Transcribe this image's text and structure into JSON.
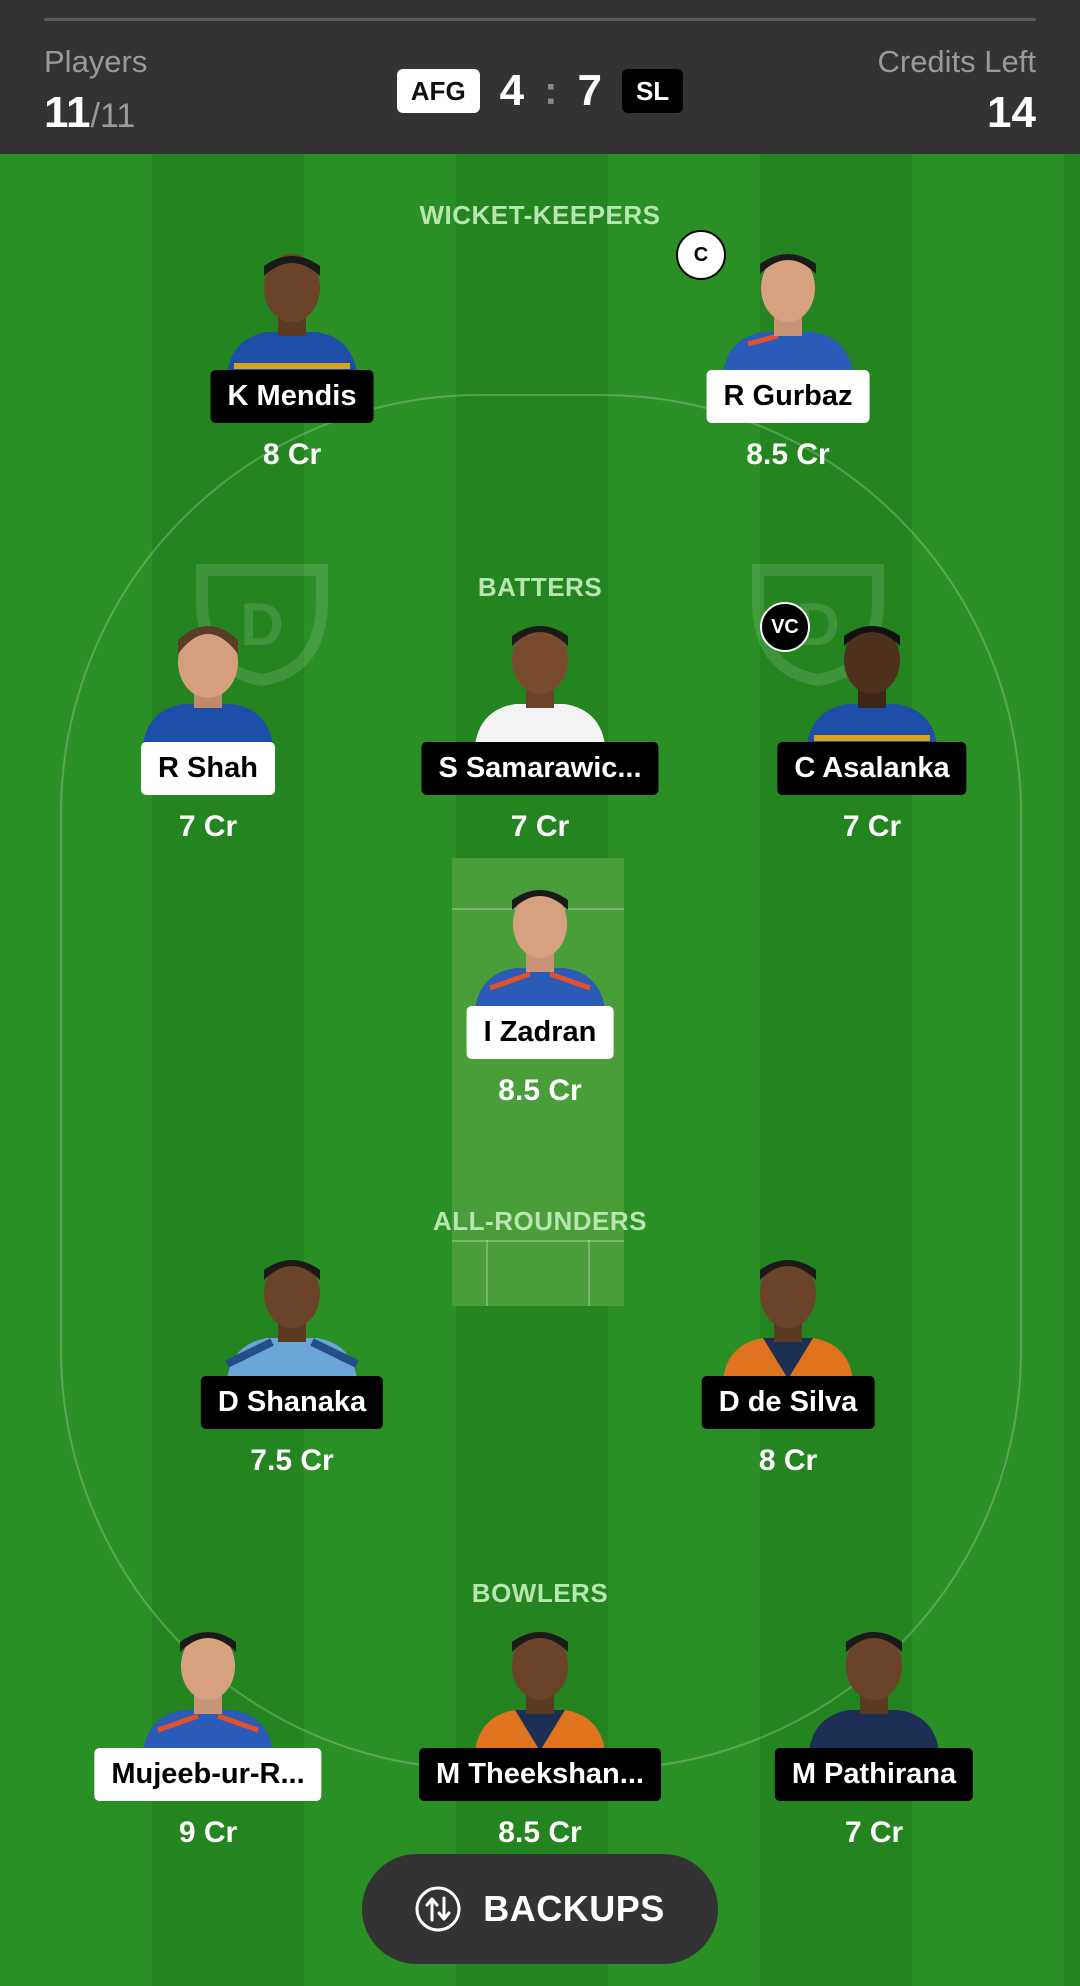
{
  "header": {
    "players_label": "Players",
    "players_count": "11",
    "players_total": "/11",
    "credits_label": "Credits Left",
    "credits_value": "14",
    "team1": "AFG",
    "team1_score": "4",
    "separator": ":",
    "team2_score": "7",
    "team2": "SL"
  },
  "sections": {
    "wicket_keepers": "WICKET-KEEPERS",
    "batters": "BATTERS",
    "all_rounders": "ALL-ROUNDERS",
    "bowlers": "BOWLERS"
  },
  "players": [
    {
      "name": "K Mendis",
      "credits": "8 Cr",
      "team": "SL",
      "label_style": "dark"
    },
    {
      "name": "R Gurbaz",
      "credits": "8.5 Cr",
      "team": "AFG",
      "label_style": "light",
      "role": "C"
    },
    {
      "name": "R Shah",
      "credits": "7 Cr",
      "team": "AFG",
      "label_style": "light"
    },
    {
      "name": "S Samarawic...",
      "credits": "7 Cr",
      "team": "SL",
      "label_style": "dark"
    },
    {
      "name": "C Asalanka",
      "credits": "7 Cr",
      "team": "SL",
      "label_style": "dark",
      "role": "VC"
    },
    {
      "name": "I Zadran",
      "credits": "8.5 Cr",
      "team": "AFG",
      "label_style": "light"
    },
    {
      "name": "D Shanaka",
      "credits": "7.5 Cr",
      "team": "SL",
      "label_style": "dark"
    },
    {
      "name": "D de Silva",
      "credits": "8 Cr",
      "team": "SL",
      "label_style": "dark"
    },
    {
      "name": "Mujeeb-ur-R...",
      "credits": "9 Cr",
      "team": "AFG",
      "label_style": "light"
    },
    {
      "name": "M Theekshan...",
      "credits": "8.5 Cr",
      "team": "SL",
      "label_style": "dark"
    },
    {
      "name": "M Pathirana",
      "credits": "7 Cr",
      "team": "SL",
      "label_style": "dark"
    }
  ],
  "backups": {
    "label": "BACKUPS",
    "icon": "swap-icon"
  },
  "colors": {
    "field_light": "#2a8f24",
    "field_dark": "#238420",
    "header": "#333333",
    "pitch": "#4a9e3a"
  }
}
